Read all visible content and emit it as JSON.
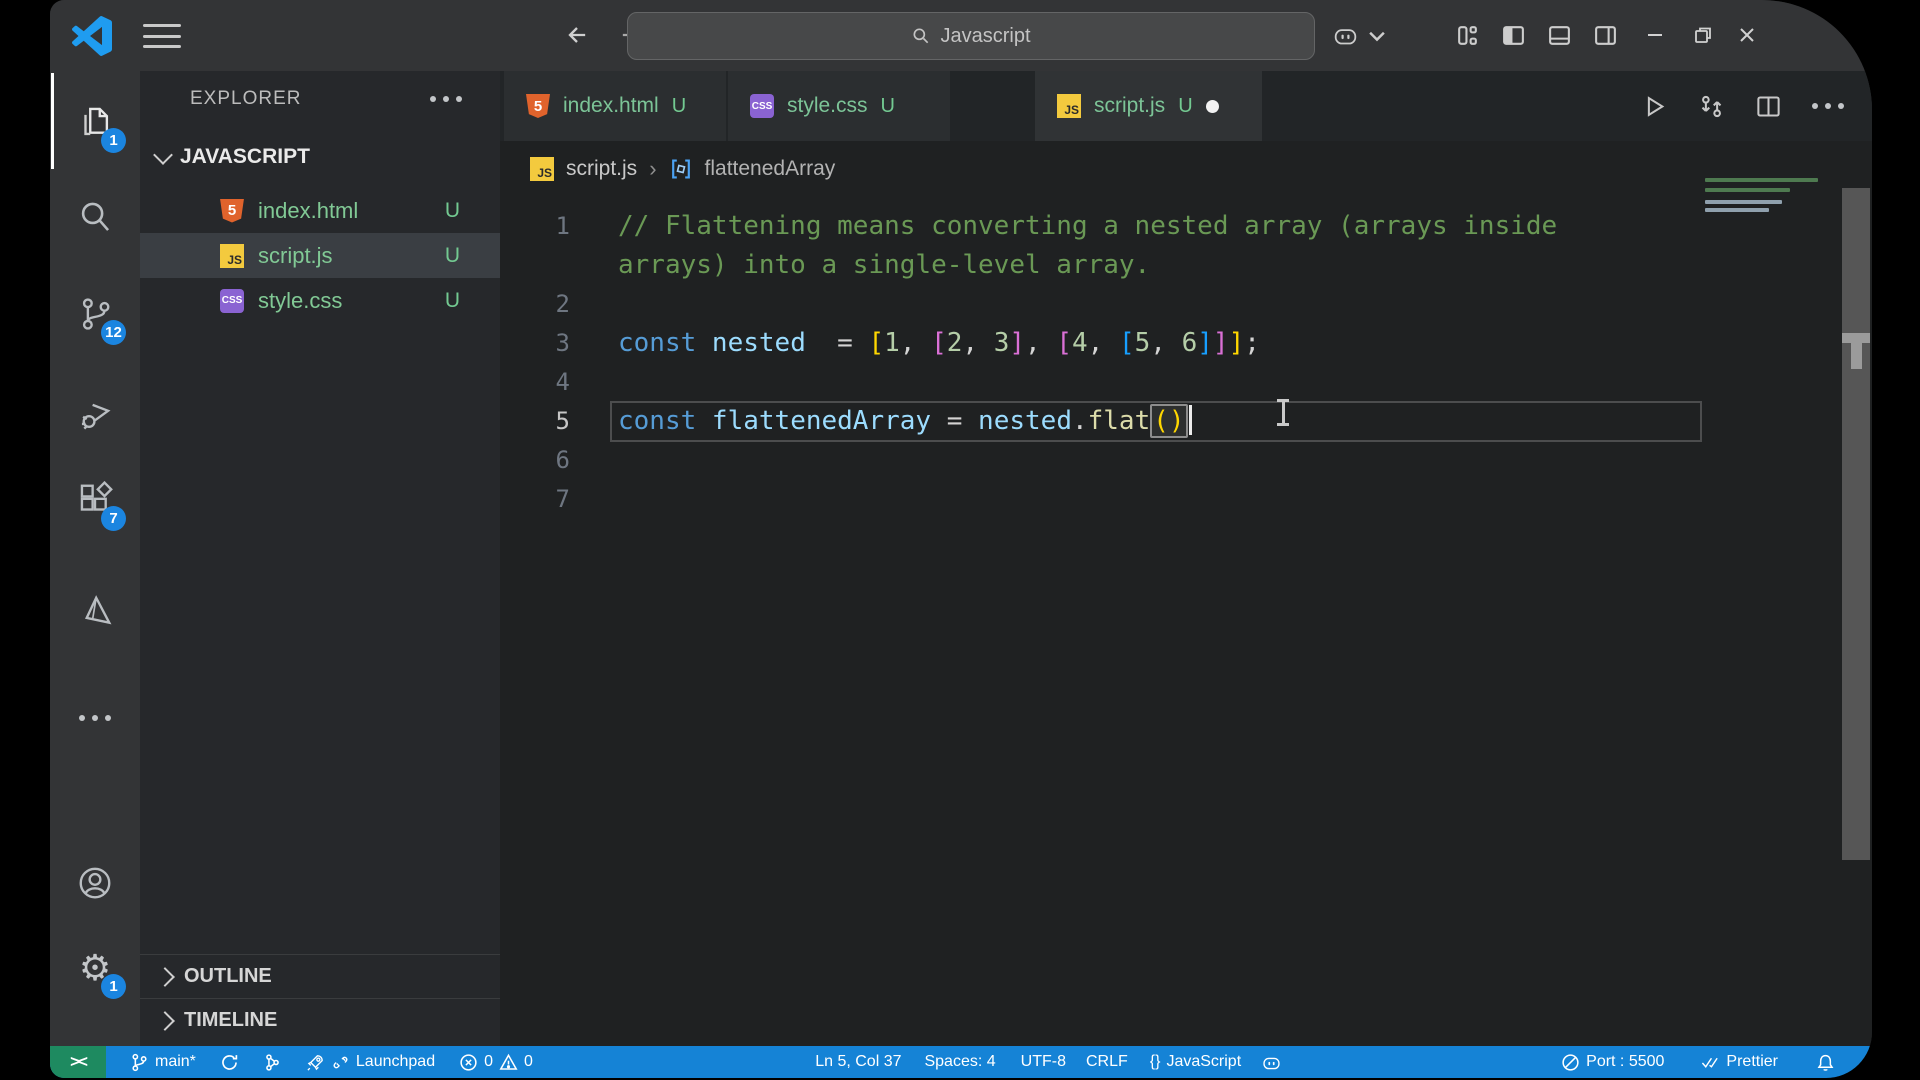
{
  "titlebar": {
    "search": "Javascript"
  },
  "activity_bar": {
    "badges": {
      "explorer": "1",
      "source_control": "12",
      "extensions": "7",
      "settings": "1"
    }
  },
  "icons": {
    "gear": "⚙",
    "html_label": "5",
    "js_label": "JS",
    "css_label": "CSS"
  },
  "sidebar": {
    "title": "EXPLORER",
    "section": "JAVASCRIPT",
    "files": [
      {
        "name": "index.html",
        "git": "U"
      },
      {
        "name": "script.js",
        "git": "U"
      },
      {
        "name": "style.css",
        "git": "U"
      }
    ],
    "panes": [
      {
        "label": "OUTLINE"
      },
      {
        "label": "TIMELINE"
      }
    ]
  },
  "tabs": [
    {
      "name": "index.html",
      "git": "U"
    },
    {
      "name": "style.css",
      "git": "U"
    },
    {
      "name": "script.js",
      "git": "U"
    }
  ],
  "breadcrumb": {
    "file": "script.js",
    "symbol": "flattenedArray"
  },
  "code": {
    "lines": [
      {
        "num": "1",
        "rows": [
          [
            {
              "t": "// Flattening means converting a nested array (arrays inside",
              "c": "comment"
            }
          ],
          [
            {
              "t": "arrays) into a single-level array.",
              "c": "comment"
            }
          ]
        ]
      },
      {
        "num": "2",
        "rows": [
          []
        ]
      },
      {
        "num": "3",
        "rows": [
          [
            {
              "t": "const ",
              "c": "kw"
            },
            {
              "t": "nested",
              "c": "var"
            },
            {
              "t": "  = ",
              "c": "punc"
            },
            {
              "t": "[",
              "c": "b1"
            },
            {
              "t": "1",
              "c": "num"
            },
            {
              "t": ", ",
              "c": "punc"
            },
            {
              "t": "[",
              "c": "b2"
            },
            {
              "t": "2",
              "c": "num"
            },
            {
              "t": ", ",
              "c": "punc"
            },
            {
              "t": "3",
              "c": "num"
            },
            {
              "t": "]",
              "c": "b2"
            },
            {
              "t": ", ",
              "c": "punc"
            },
            {
              "t": "[",
              "c": "b2"
            },
            {
              "t": "4",
              "c": "num"
            },
            {
              "t": ", ",
              "c": "punc"
            },
            {
              "t": "[",
              "c": "b3"
            },
            {
              "t": "5",
              "c": "num"
            },
            {
              "t": ", ",
              "c": "punc"
            },
            {
              "t": "6",
              "c": "num"
            },
            {
              "t": "]",
              "c": "b3"
            },
            {
              "t": "]",
              "c": "b2"
            },
            {
              "t": "]",
              "c": "b1"
            },
            {
              "t": ";",
              "c": "punc"
            }
          ]
        ]
      },
      {
        "num": "4",
        "rows": [
          []
        ]
      },
      {
        "num": "5",
        "current": true,
        "rows": [
          [
            {
              "t": "const ",
              "c": "kw"
            },
            {
              "t": "flattenedArray",
              "c": "var"
            },
            {
              "t": " = ",
              "c": "punc"
            },
            {
              "t": "nested",
              "c": "var"
            },
            {
              "t": ".",
              "c": "punc"
            },
            {
              "t": "flat",
              "c": "fn"
            },
            {
              "t": "()",
              "c": "b1",
              "box": true,
              "cursor": true
            }
          ]
        ]
      },
      {
        "num": "6",
        "rows": [
          []
        ]
      },
      {
        "num": "7",
        "rows": [
          []
        ]
      }
    ]
  },
  "status_bar": {
    "remote_glyph": "><",
    "branch": "main*",
    "launchpad": "Launchpad",
    "errors": "0",
    "warnings": "0",
    "line_col": "Ln 5, Col 37",
    "spaces": "Spaces: 4",
    "encoding": "UTF-8",
    "eol": "CRLF",
    "lang_icon": "{}",
    "language": "JavaScript",
    "port": "Port : 5500",
    "formatter": "Prettier"
  }
}
